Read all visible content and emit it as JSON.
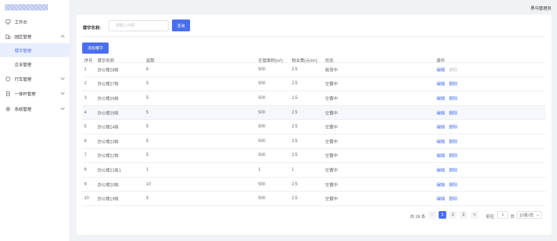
{
  "sidebar": {
    "items": [
      {
        "label": "工作台",
        "icon": "monitor-icon"
      },
      {
        "label": "园区管理",
        "icon": "building-icon",
        "expanded": true,
        "children": [
          {
            "label": "楼宇管理",
            "active": true
          },
          {
            "label": "企业管理",
            "active": false
          }
        ]
      },
      {
        "label": "行车管理",
        "icon": "car-icon"
      },
      {
        "label": "一体杆管理",
        "icon": "pole-icon"
      },
      {
        "label": "系统管理",
        "icon": "gear-icon"
      }
    ]
  },
  "header": {
    "user_name": "黑马管理员"
  },
  "search": {
    "label": "楼宇名称:",
    "placeholder": "请输入内容",
    "button": "查询"
  },
  "toolbar": {
    "add_label": "添加楼宇"
  },
  "table": {
    "columns": [
      "序号",
      "楼宇名称",
      "层数",
      "在管面积(m²)",
      "物业费(元/m²)",
      "状态",
      "操作"
    ],
    "rows": [
      {
        "idx": "1",
        "name": "办公楼28栋",
        "floors": "6",
        "area": "500",
        "fee": "2.5",
        "status": "租赁中",
        "edit": "编辑",
        "del": "删除",
        "del_disabled": true
      },
      {
        "idx": "2",
        "name": "办公楼27栋",
        "floors": "5",
        "area": "500",
        "fee": "2.5",
        "status": "空置中",
        "edit": "编辑",
        "del": "删除",
        "del_disabled": false
      },
      {
        "idx": "3",
        "name": "办公楼26栋",
        "floors": "5",
        "area": "500",
        "fee": "2.5",
        "status": "空置中",
        "edit": "编辑",
        "del": "删除",
        "del_disabled": false
      },
      {
        "idx": "4",
        "name": "办公楼25栋",
        "floors": "5",
        "area": "500",
        "fee": "2.5",
        "status": "空置中",
        "edit": "编辑",
        "del": "删除",
        "del_disabled": false
      },
      {
        "idx": "5",
        "name": "办公楼24栋",
        "floors": "5",
        "area": "500",
        "fee": "2.5",
        "status": "空置中",
        "edit": "编辑",
        "del": "删除",
        "del_disabled": false
      },
      {
        "idx": "6",
        "name": "办公楼23栋",
        "floors": "5",
        "area": "500",
        "fee": "2.5",
        "status": "空置中",
        "edit": "编辑",
        "del": "删除",
        "del_disabled": false
      },
      {
        "idx": "7",
        "name": "办公楼22栋",
        "floors": "5",
        "area": "500",
        "fee": "2.5",
        "status": "空置中",
        "edit": "编辑",
        "del": "删除",
        "del_disabled": false
      },
      {
        "idx": "8",
        "name": "办公楼21栋1",
        "floors": "1",
        "area": "1",
        "fee": "1",
        "status": "空置中",
        "edit": "编辑",
        "del": "删除",
        "del_disabled": false
      },
      {
        "idx": "9",
        "name": "办公楼20栋",
        "floors": "10",
        "area": "500",
        "fee": "2.5",
        "status": "空置中",
        "edit": "编辑",
        "del": "删除",
        "del_disabled": false
      },
      {
        "idx": "10",
        "name": "办公楼19栋",
        "floors": "5",
        "area": "500",
        "fee": "2.5",
        "status": "空置中",
        "edit": "编辑",
        "del": "删除",
        "del_disabled": false
      }
    ],
    "hover_row": 4
  },
  "pagination": {
    "total_text": "共 28 条",
    "pages": [
      "1",
      "2",
      "3"
    ],
    "current": "1",
    "prev": "<",
    "next": ">",
    "goto_label": "前往",
    "goto_value": "1",
    "page_unit": "页",
    "page_size": "10条/页"
  },
  "colors": {
    "primary": "#4a6ef0",
    "active_bg": "#e8eefc"
  }
}
